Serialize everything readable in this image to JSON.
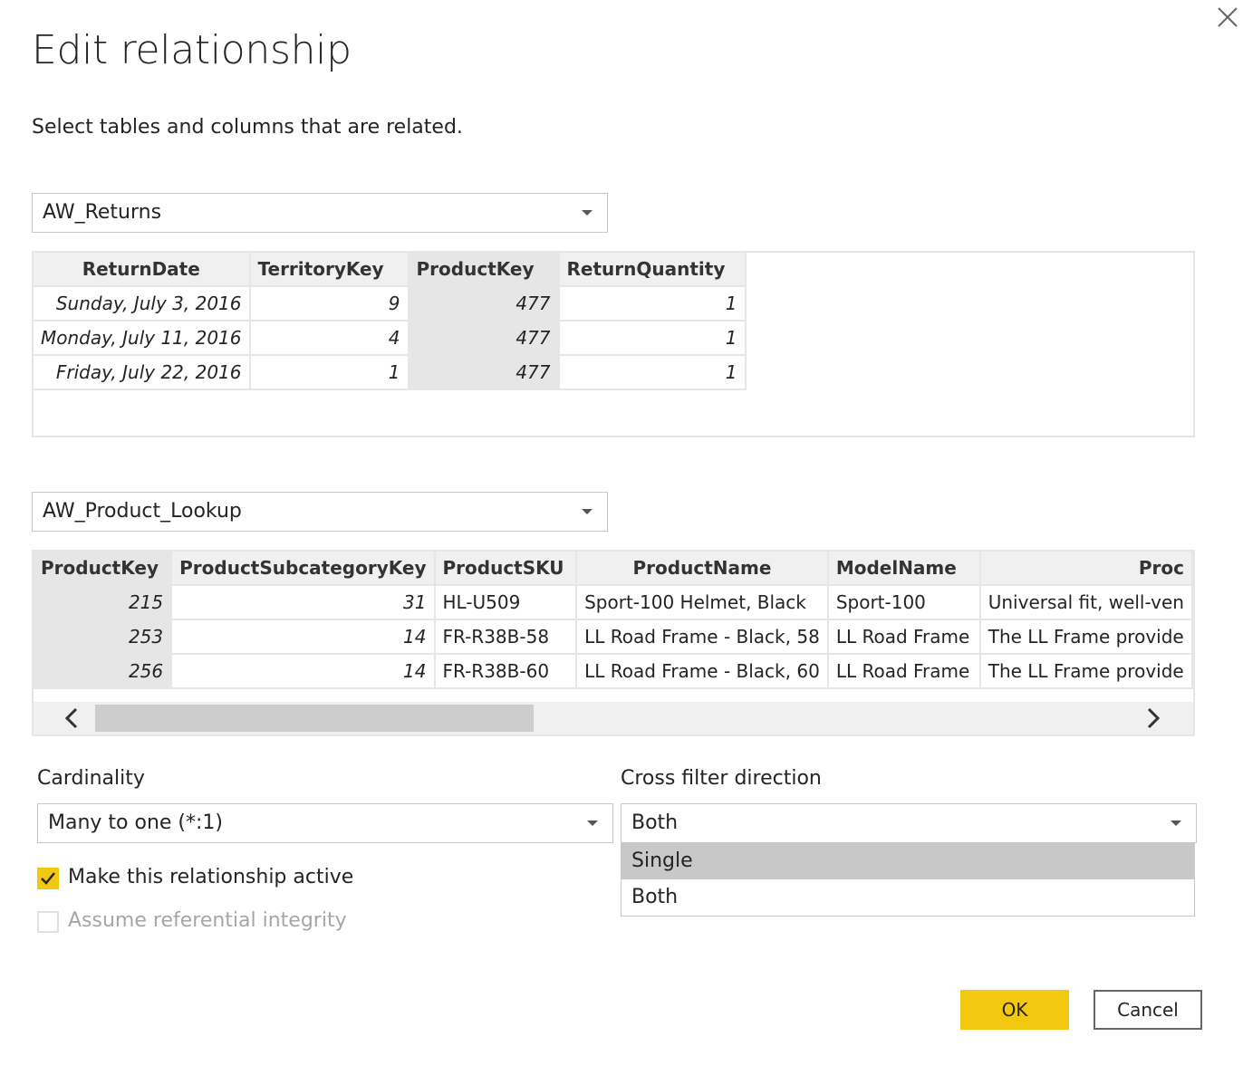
{
  "dialog": {
    "title": "Edit relationship",
    "subtitle": "Select tables and columns that are related."
  },
  "table1": {
    "selected": "AW_Returns",
    "columns": [
      "ReturnDate",
      "TerritoryKey",
      "ProductKey",
      "ReturnQuantity"
    ],
    "rows": [
      [
        "Sunday, July 3, 2016",
        "9",
        "477",
        "1"
      ],
      [
        "Monday, July 11, 2016",
        "4",
        "477",
        "1"
      ],
      [
        "Friday, July 22, 2016",
        "1",
        "477",
        "1"
      ]
    ]
  },
  "table2": {
    "selected": "AW_Product_Lookup",
    "columns": [
      "ProductKey",
      "ProductSubcategoryKey",
      "ProductSKU",
      "ProductName",
      "ModelName",
      "Proc"
    ],
    "rows": [
      [
        "215",
        "31",
        "HL-U509",
        "Sport-100 Helmet, Black",
        "Sport-100",
        "Universal fit, well-ven"
      ],
      [
        "253",
        "14",
        "FR-R38B-58",
        "LL Road Frame - Black, 58",
        "LL Road Frame",
        "The LL Frame provide"
      ],
      [
        "256",
        "14",
        "FR-R38B-60",
        "LL Road Frame - Black, 60",
        "LL Road Frame",
        "The LL Frame provide"
      ]
    ],
    "scroll_position": 0
  },
  "cardinality": {
    "label": "Cardinality",
    "value": "Many to one (*:1)"
  },
  "cross_filter": {
    "label": "Cross filter direction",
    "value": "Both",
    "options": [
      "Single",
      "Both"
    ],
    "highlighted": "Single"
  },
  "options": {
    "active_label": "Make this relationship active",
    "active_checked": true,
    "integrity_label": "Assume referential integrity",
    "integrity_checked": false,
    "integrity_enabled": false
  },
  "buttons": {
    "ok": "OK",
    "cancel": "Cancel"
  },
  "colors": {
    "accent": "#f2c811",
    "highlight": "#c8c8c8",
    "grid_header": "#f0f0f0"
  },
  "icons": {
    "close": "close-icon",
    "caret": "chevron-down-icon",
    "check": "check-icon",
    "scroll_left": "chevron-left-icon",
    "scroll_right": "chevron-right-icon"
  }
}
